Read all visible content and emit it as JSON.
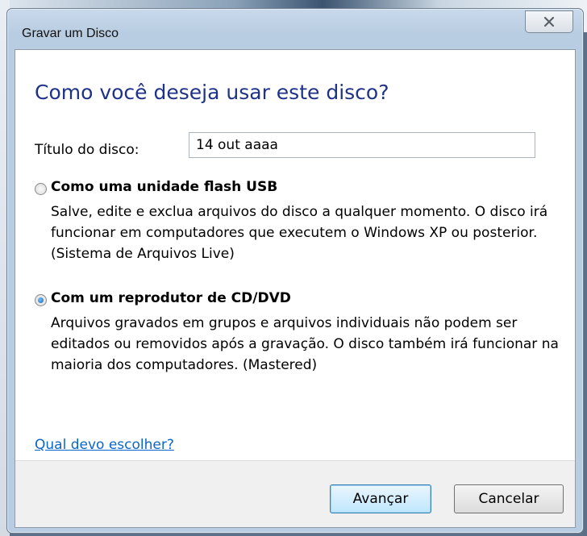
{
  "window": {
    "title": "Gravar um Disco"
  },
  "dialog": {
    "heading": "Como você deseja usar este disco?",
    "disc_title_label": "Título do disco:",
    "disc_title_value": "14 out aaaa",
    "options": [
      {
        "title": "Como uma unidade flash USB",
        "description": "Salve, edite e exclua arquivos do disco a qualquer momento. O disco irá funcionar em computadores que executem o Windows XP ou posterior. (Sistema de Arquivos Live)",
        "selected": false
      },
      {
        "title": "Com um reprodutor de CD/DVD",
        "description": "Arquivos gravados em grupos e arquivos individuais não podem ser editados ou removidos após a gravação. O disco também irá funcionar na maioria dos computadores. (Mastered)",
        "selected": true
      }
    ],
    "help_link": "Qual devo escolher?"
  },
  "buttons": {
    "next": "Avançar",
    "cancel": "Cancelar"
  },
  "icons": {
    "close": "close-icon"
  },
  "colors": {
    "heading": "#1e3287",
    "link": "#0a66cc",
    "radio_selected": "#1d5fa8"
  }
}
